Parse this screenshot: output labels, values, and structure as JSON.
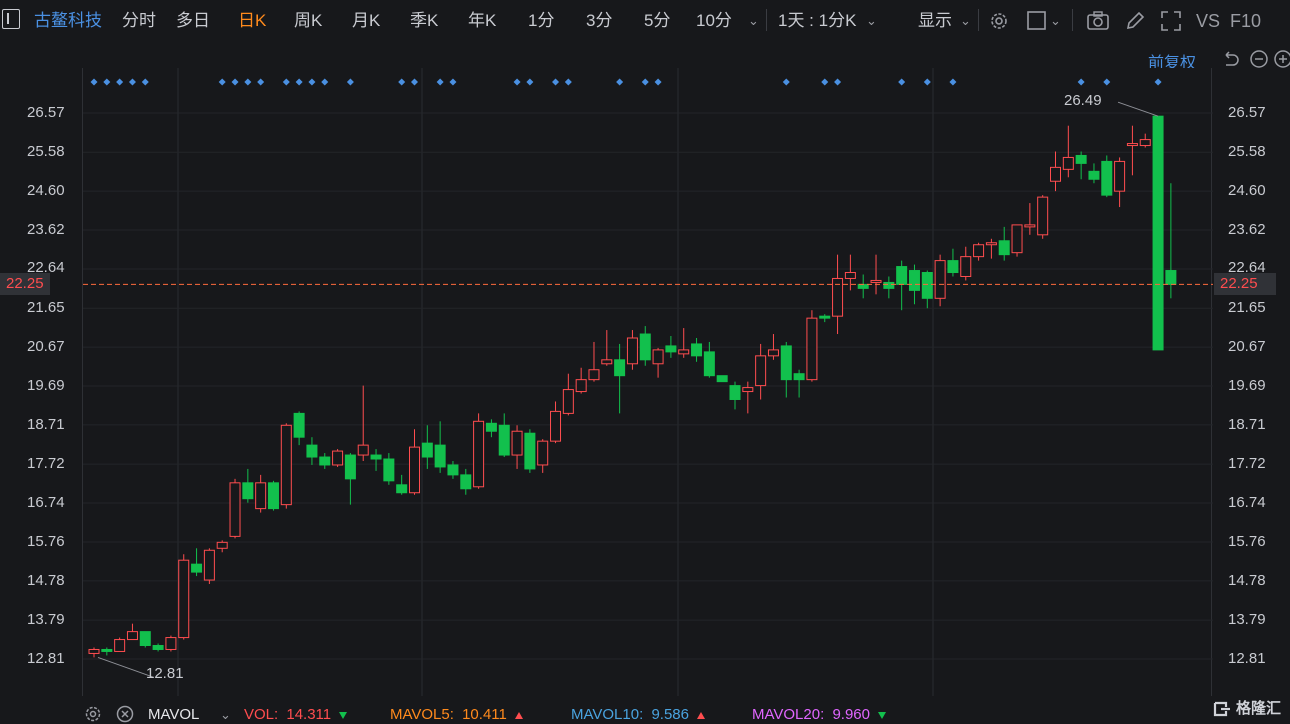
{
  "toolbar": {
    "stock_name": "古鳌科技",
    "periods": [
      "分时",
      "多日",
      "日K",
      "周K",
      "月K",
      "季K",
      "年K",
      "1分",
      "3分",
      "5分",
      "10分"
    ],
    "active_period": "日K",
    "interval_select": "1天 : 1分K",
    "display_label": "显示",
    "vs_label": "VS",
    "f10_label": "F10"
  },
  "chart": {
    "adjust_label": "前复权",
    "y_axis_labels": [
      "26.57",
      "25.58",
      "24.60",
      "23.62",
      "22.64",
      "21.65",
      "20.67",
      "19.69",
      "18.71",
      "17.72",
      "16.74",
      "15.76",
      "14.78",
      "13.79",
      "12.81"
    ],
    "current_price": "22.25",
    "high_label": "26.49",
    "low_label": "12.81",
    "colors": {
      "up": "#ff4d4f",
      "down": "#12c04d",
      "dot": "#4a90e2",
      "price_line": "#ff6a3d"
    }
  },
  "chart_data": {
    "type": "candlestick",
    "y_min": 12.81,
    "y_max": 26.57,
    "candles": [
      [
        12.95,
        13.05,
        12.85,
        13.1
      ],
      [
        13.05,
        13.0,
        12.9,
        13.1
      ],
      [
        13.0,
        13.3,
        13.0,
        13.35
      ],
      [
        13.3,
        13.5,
        13.3,
        13.7
      ],
      [
        13.5,
        13.15,
        13.1,
        13.5
      ],
      [
        13.15,
        13.05,
        13.0,
        13.2
      ],
      [
        13.05,
        13.35,
        13.0,
        13.4
      ],
      [
        13.35,
        15.3,
        13.3,
        15.45
      ],
      [
        15.2,
        15.0,
        14.9,
        15.6
      ],
      [
        14.8,
        15.55,
        14.7,
        15.6
      ],
      [
        15.6,
        15.75,
        15.5,
        15.8
      ],
      [
        15.9,
        17.25,
        15.85,
        17.35
      ],
      [
        17.25,
        16.85,
        16.75,
        17.6
      ],
      [
        16.6,
        17.25,
        16.5,
        17.45
      ],
      [
        17.25,
        16.6,
        16.55,
        17.3
      ],
      [
        16.7,
        18.7,
        16.6,
        18.75
      ],
      [
        19.0,
        18.4,
        18.2,
        19.05
      ],
      [
        18.2,
        17.9,
        17.7,
        18.4
      ],
      [
        17.9,
        17.7,
        17.6,
        18.0
      ],
      [
        17.7,
        18.05,
        17.65,
        18.1
      ],
      [
        17.95,
        17.35,
        16.7,
        18.0
      ],
      [
        17.95,
        18.2,
        17.8,
        19.7
      ],
      [
        17.95,
        17.85,
        17.55,
        18.1
      ],
      [
        17.85,
        17.3,
        17.2,
        18.0
      ],
      [
        17.2,
        17.0,
        16.95,
        17.45
      ],
      [
        17.0,
        18.15,
        16.95,
        18.6
      ],
      [
        18.25,
        17.9,
        17.6,
        18.7
      ],
      [
        18.2,
        17.65,
        17.5,
        18.8
      ],
      [
        17.7,
        17.45,
        17.35,
        17.8
      ],
      [
        17.45,
        17.1,
        16.95,
        17.6
      ],
      [
        17.15,
        18.8,
        17.1,
        19.0
      ],
      [
        18.75,
        18.55,
        18.4,
        18.85
      ],
      [
        18.7,
        17.95,
        17.9,
        19.0
      ],
      [
        17.95,
        18.55,
        17.6,
        18.7
      ],
      [
        18.5,
        17.6,
        17.5,
        18.6
      ],
      [
        17.7,
        18.3,
        17.5,
        18.35
      ],
      [
        18.3,
        19.05,
        18.25,
        19.3
      ],
      [
        19.0,
        19.6,
        18.95,
        20.0
      ],
      [
        19.55,
        19.85,
        19.5,
        20.15
      ],
      [
        19.85,
        20.1,
        19.8,
        20.8
      ],
      [
        20.25,
        20.35,
        20.2,
        21.1
      ],
      [
        20.35,
        19.95,
        19.0,
        20.75
      ],
      [
        20.25,
        20.9,
        20.1,
        21.1
      ],
      [
        21.0,
        20.35,
        20.2,
        21.2
      ],
      [
        20.25,
        20.6,
        19.9,
        20.65
      ],
      [
        20.7,
        20.55,
        20.4,
        20.95
      ],
      [
        20.5,
        20.6,
        20.4,
        21.15
      ],
      [
        20.75,
        20.45,
        20.3,
        20.9
      ],
      [
        20.55,
        19.95,
        19.9,
        20.8
      ],
      [
        19.95,
        19.8,
        19.8,
        19.95
      ],
      [
        19.7,
        19.35,
        19.1,
        19.8
      ],
      [
        19.55,
        19.65,
        19.0,
        19.8
      ],
      [
        19.7,
        20.45,
        19.35,
        20.75
      ],
      [
        20.45,
        20.6,
        20.35,
        21.0
      ],
      [
        20.7,
        19.85,
        19.4,
        20.8
      ],
      [
        20.0,
        19.85,
        19.4,
        20.1
      ],
      [
        19.85,
        21.4,
        19.8,
        21.6
      ],
      [
        21.45,
        21.4,
        21.3,
        21.5
      ],
      [
        21.45,
        22.4,
        21.0,
        23.0
      ],
      [
        22.4,
        22.55,
        22.1,
        23.0
      ],
      [
        22.25,
        22.15,
        21.9,
        22.5
      ],
      [
        22.3,
        22.35,
        22.0,
        23.0
      ],
      [
        22.3,
        22.15,
        21.9,
        22.45
      ],
      [
        22.7,
        22.25,
        21.6,
        22.85
      ],
      [
        22.6,
        22.1,
        21.75,
        22.75
      ],
      [
        22.55,
        21.9,
        21.65,
        22.6
      ],
      [
        21.9,
        22.85,
        21.7,
        23.0
      ],
      [
        22.85,
        22.55,
        22.45,
        23.15
      ],
      [
        22.45,
        22.95,
        22.35,
        23.2
      ],
      [
        22.95,
        23.25,
        22.85,
        23.3
      ],
      [
        23.25,
        23.3,
        22.9,
        23.4
      ],
      [
        23.35,
        23.0,
        22.85,
        23.7
      ],
      [
        23.05,
        23.75,
        22.95,
        23.75
      ],
      [
        23.7,
        23.75,
        23.5,
        24.3
      ],
      [
        23.5,
        24.45,
        23.4,
        24.5
      ],
      [
        24.85,
        25.2,
        24.6,
        25.6
      ],
      [
        25.15,
        25.45,
        24.95,
        26.25
      ],
      [
        25.5,
        25.3,
        24.9,
        25.6
      ],
      [
        25.1,
        24.9,
        24.8,
        25.3
      ],
      [
        25.35,
        24.5,
        24.45,
        25.5
      ],
      [
        24.6,
        25.35,
        24.2,
        25.45
      ],
      [
        25.75,
        25.8,
        25.0,
        26.25
      ],
      [
        25.75,
        25.9,
        25.7,
        26.05
      ],
      [
        26.49,
        20.6,
        20.6,
        26.49
      ],
      [
        22.6,
        22.25,
        21.9,
        24.8
      ]
    ],
    "signal_dots": [
      0,
      1,
      2,
      3,
      4,
      10,
      11,
      12,
      13,
      15,
      16,
      17,
      18,
      20,
      24,
      25,
      27,
      28,
      33,
      34,
      36,
      37,
      41,
      43,
      44,
      54,
      57,
      58,
      63,
      65,
      67,
      77,
      79,
      83
    ]
  },
  "indicators": {
    "main": "MAVOL",
    "vol_label": "VOL:",
    "vol_value": "14.311",
    "mavol5_label": "MAVOL5:",
    "mavol5_value": "10.411",
    "mavol10_label": "MAVOL10:",
    "mavol10_value": "9.586",
    "mavol20_label": "MAVOL20:",
    "mavol20_value": "9.960",
    "colors": {
      "vol": "#ff4d4f",
      "mavol5": "#ff8a1c",
      "mavol10": "#4aa3df",
      "mavol20": "#e066ff"
    }
  },
  "brand": "格隆汇"
}
